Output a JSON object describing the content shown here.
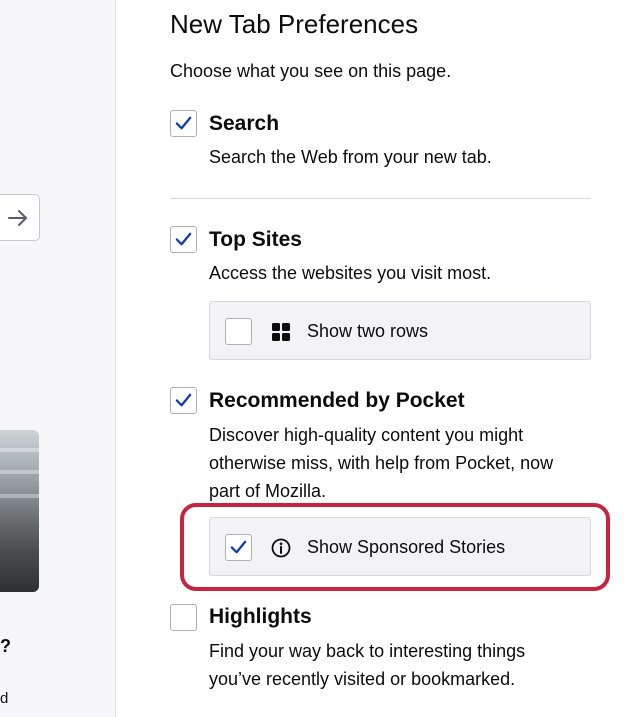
{
  "background_page": {
    "arrow_glyph": "→",
    "question_fragment": "?",
    "text_fragment": "d"
  },
  "preferences": {
    "title": "New Tab Preferences",
    "subtitle": "Choose what you see on this page.",
    "sections": {
      "search": {
        "label": "Search",
        "checked": true,
        "description": "Search the Web from your new tab."
      },
      "top_sites": {
        "label": "Top Sites",
        "checked": true,
        "description": "Access the websites you visit most.",
        "option": {
          "label": "Show two rows",
          "checked": false,
          "icon": "grid-icon"
        }
      },
      "pocket": {
        "label": "Recommended by Pocket",
        "checked": true,
        "description_lines": [
          "Discover high-quality content you might",
          "otherwise miss, with help from Pocket, now",
          "part of Mozilla."
        ],
        "option": {
          "label": "Show Sponsored Stories",
          "checked": true,
          "icon": "info-icon"
        }
      },
      "highlights": {
        "label": "Highlights",
        "checked": false,
        "description_lines": [
          "Find your way back to interesting things",
          "you’ve recently visited or bookmarked."
        ]
      }
    }
  },
  "colors": {
    "check_mark": "#0a3cb4",
    "highlight_ring": "#c8233f",
    "subbox_bg": "#f3f3f5"
  }
}
